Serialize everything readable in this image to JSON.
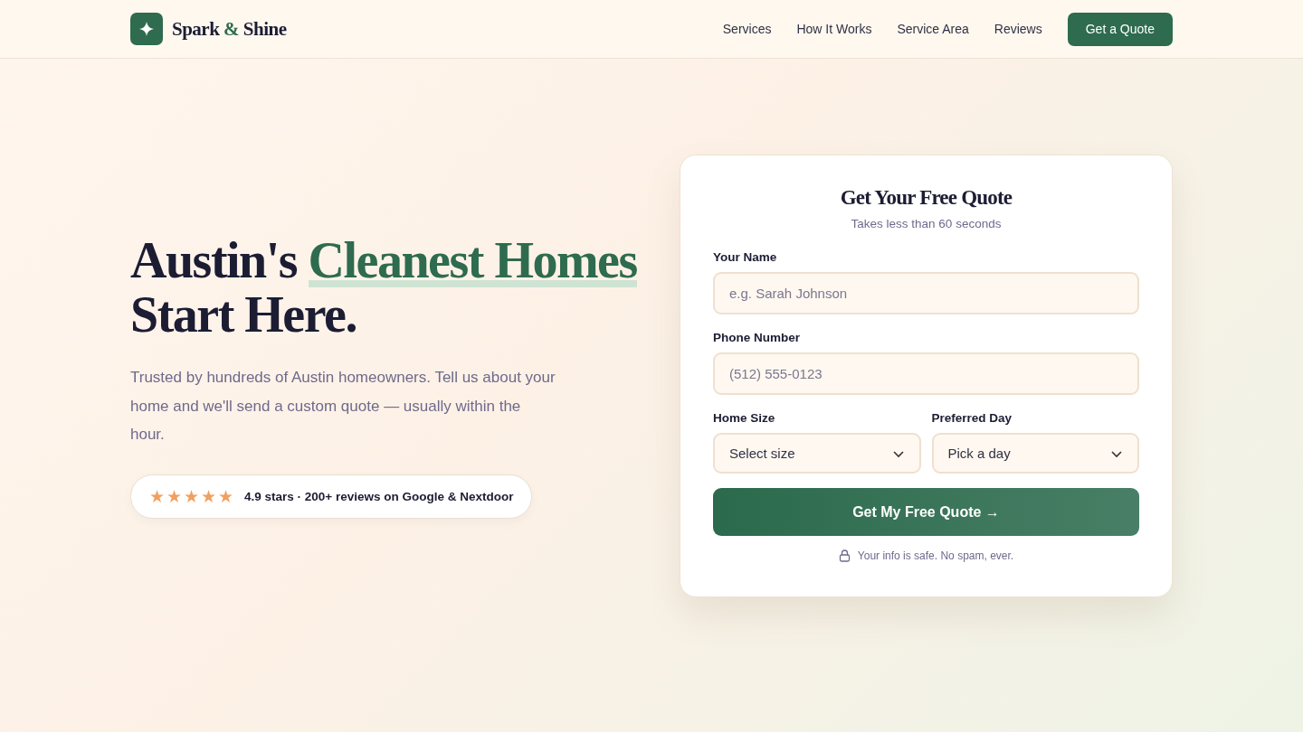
{
  "brand": {
    "name_start": "Spark",
    "name_amp": "&",
    "name_end": "Shine"
  },
  "nav": {
    "links": [
      {
        "label": "Services"
      },
      {
        "label": "How It Works"
      },
      {
        "label": "Service Area"
      },
      {
        "label": "Reviews"
      }
    ],
    "cta": "Get a Quote"
  },
  "hero": {
    "title_start": "Austin's",
    "title_highlight": "Cleanest Homes",
    "title_end": "Start Here.",
    "subtitle": "Trusted by hundreds of Austin homeowners. Tell us about your home and we'll send a custom quote — usually within the hour.",
    "rating": {
      "stars": 5,
      "text": "4.9 stars · 200+ reviews on Google & Nextdoor"
    }
  },
  "form": {
    "title": "Get Your Free Quote",
    "subtitle": "Takes less than 60 seconds",
    "fields": [
      {
        "label": "Your Name",
        "placeholder": "e.g. Sarah Johnson"
      },
      {
        "label": "Phone Number",
        "placeholder": "(512) 555-0123"
      }
    ],
    "selects": [
      {
        "label": "Home Size",
        "value": "Select size"
      },
      {
        "label": "Preferred Day",
        "value": "Pick a day"
      }
    ],
    "submit": "Get My Free Quote →",
    "note": "Your info is safe. No spam, ever."
  }
}
